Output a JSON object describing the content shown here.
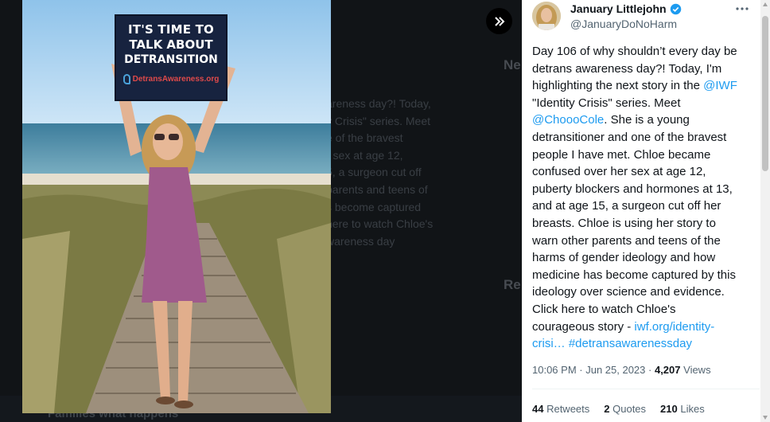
{
  "author": {
    "name": "January Littlejohn",
    "handle": "@JanuaryDoNoHarm"
  },
  "tweet": {
    "lines": [
      [
        {
          "t": "Day 106 of why shouldn’t every day be"
        }
      ],
      [
        {
          "t": "detrans awareness day?! Today, I'm"
        }
      ],
      [
        {
          "t": "highlighting the next story in the "
        },
        {
          "t": "@IWF",
          "link": true
        }
      ],
      [
        {
          "t": "\"Identity Crisis\" series. Meet"
        }
      ],
      [
        {
          "t": "@ChoooCole",
          "link": true
        },
        {
          "t": ". She is a young"
        }
      ],
      [
        {
          "t": "detransitioner and one of the bravest"
        }
      ],
      [
        {
          "t": "people I have met. Chloe became"
        }
      ],
      [
        {
          "t": "confused over her sex at age 12,"
        }
      ],
      [
        {
          "t": "puberty blockers and hormones at 13,"
        }
      ],
      [
        {
          "t": "and at age 15, a surgeon cut off her"
        }
      ],
      [
        {
          "t": "breasts. Chloe is using her story to"
        }
      ],
      [
        {
          "t": "warn other parents and teens of the"
        }
      ],
      [
        {
          "t": "harms of gender ideology and how"
        }
      ],
      [
        {
          "t": "medicine has become captured by this"
        }
      ],
      [
        {
          "t": "ideology over science and evidence."
        }
      ],
      [
        {
          "t": "Click here to watch Chloe's"
        }
      ],
      [
        {
          "t": "courageous story - "
        },
        {
          "t": "iwf.org/identity-",
          "link": true
        }
      ],
      [
        {
          "t": "crisi…",
          "link": true
        },
        {
          "t": " "
        },
        {
          "t": "#detransawarenessday",
          "link": true
        }
      ]
    ]
  },
  "meta": {
    "time": "10:06 PM",
    "sep1": " · ",
    "date": "Jun 25, 2023",
    "sep2": " · ",
    "views_count": "4,207",
    "views_label": " Views"
  },
  "stats": {
    "retweets_count": "44",
    "retweets_label": " Retweets",
    "quotes_count": "2",
    "quotes_label": " Quotes",
    "likes_count": "210",
    "likes_label": " Likes"
  },
  "sign": {
    "line1": "IT'S TIME TO",
    "line2": "TALK ABOUT",
    "line3": "DETRANSITION",
    "site": "DetransAwareness.org"
  },
  "background": {
    "ghost_lines": [
      "areness day?! Today,",
      "y Crisis\" series. Meet",
      "e of the bravest",
      "r sex at age 12,",
      "5, a surgeon cut off",
      "parents and teens of",
      "s become captured",
      "here to watch Chloe's",
      "wareness day"
    ],
    "ghost_head_1": "Ne",
    "ghost_head_2": "Re",
    "bottom_text": "Families what happens"
  },
  "colors": {
    "link": "#1d9bf0",
    "verified": "#1d9bf0",
    "sign_bg": "#17233f",
    "sign_text": "#ffffff",
    "sign_site": "#e04a4a"
  }
}
